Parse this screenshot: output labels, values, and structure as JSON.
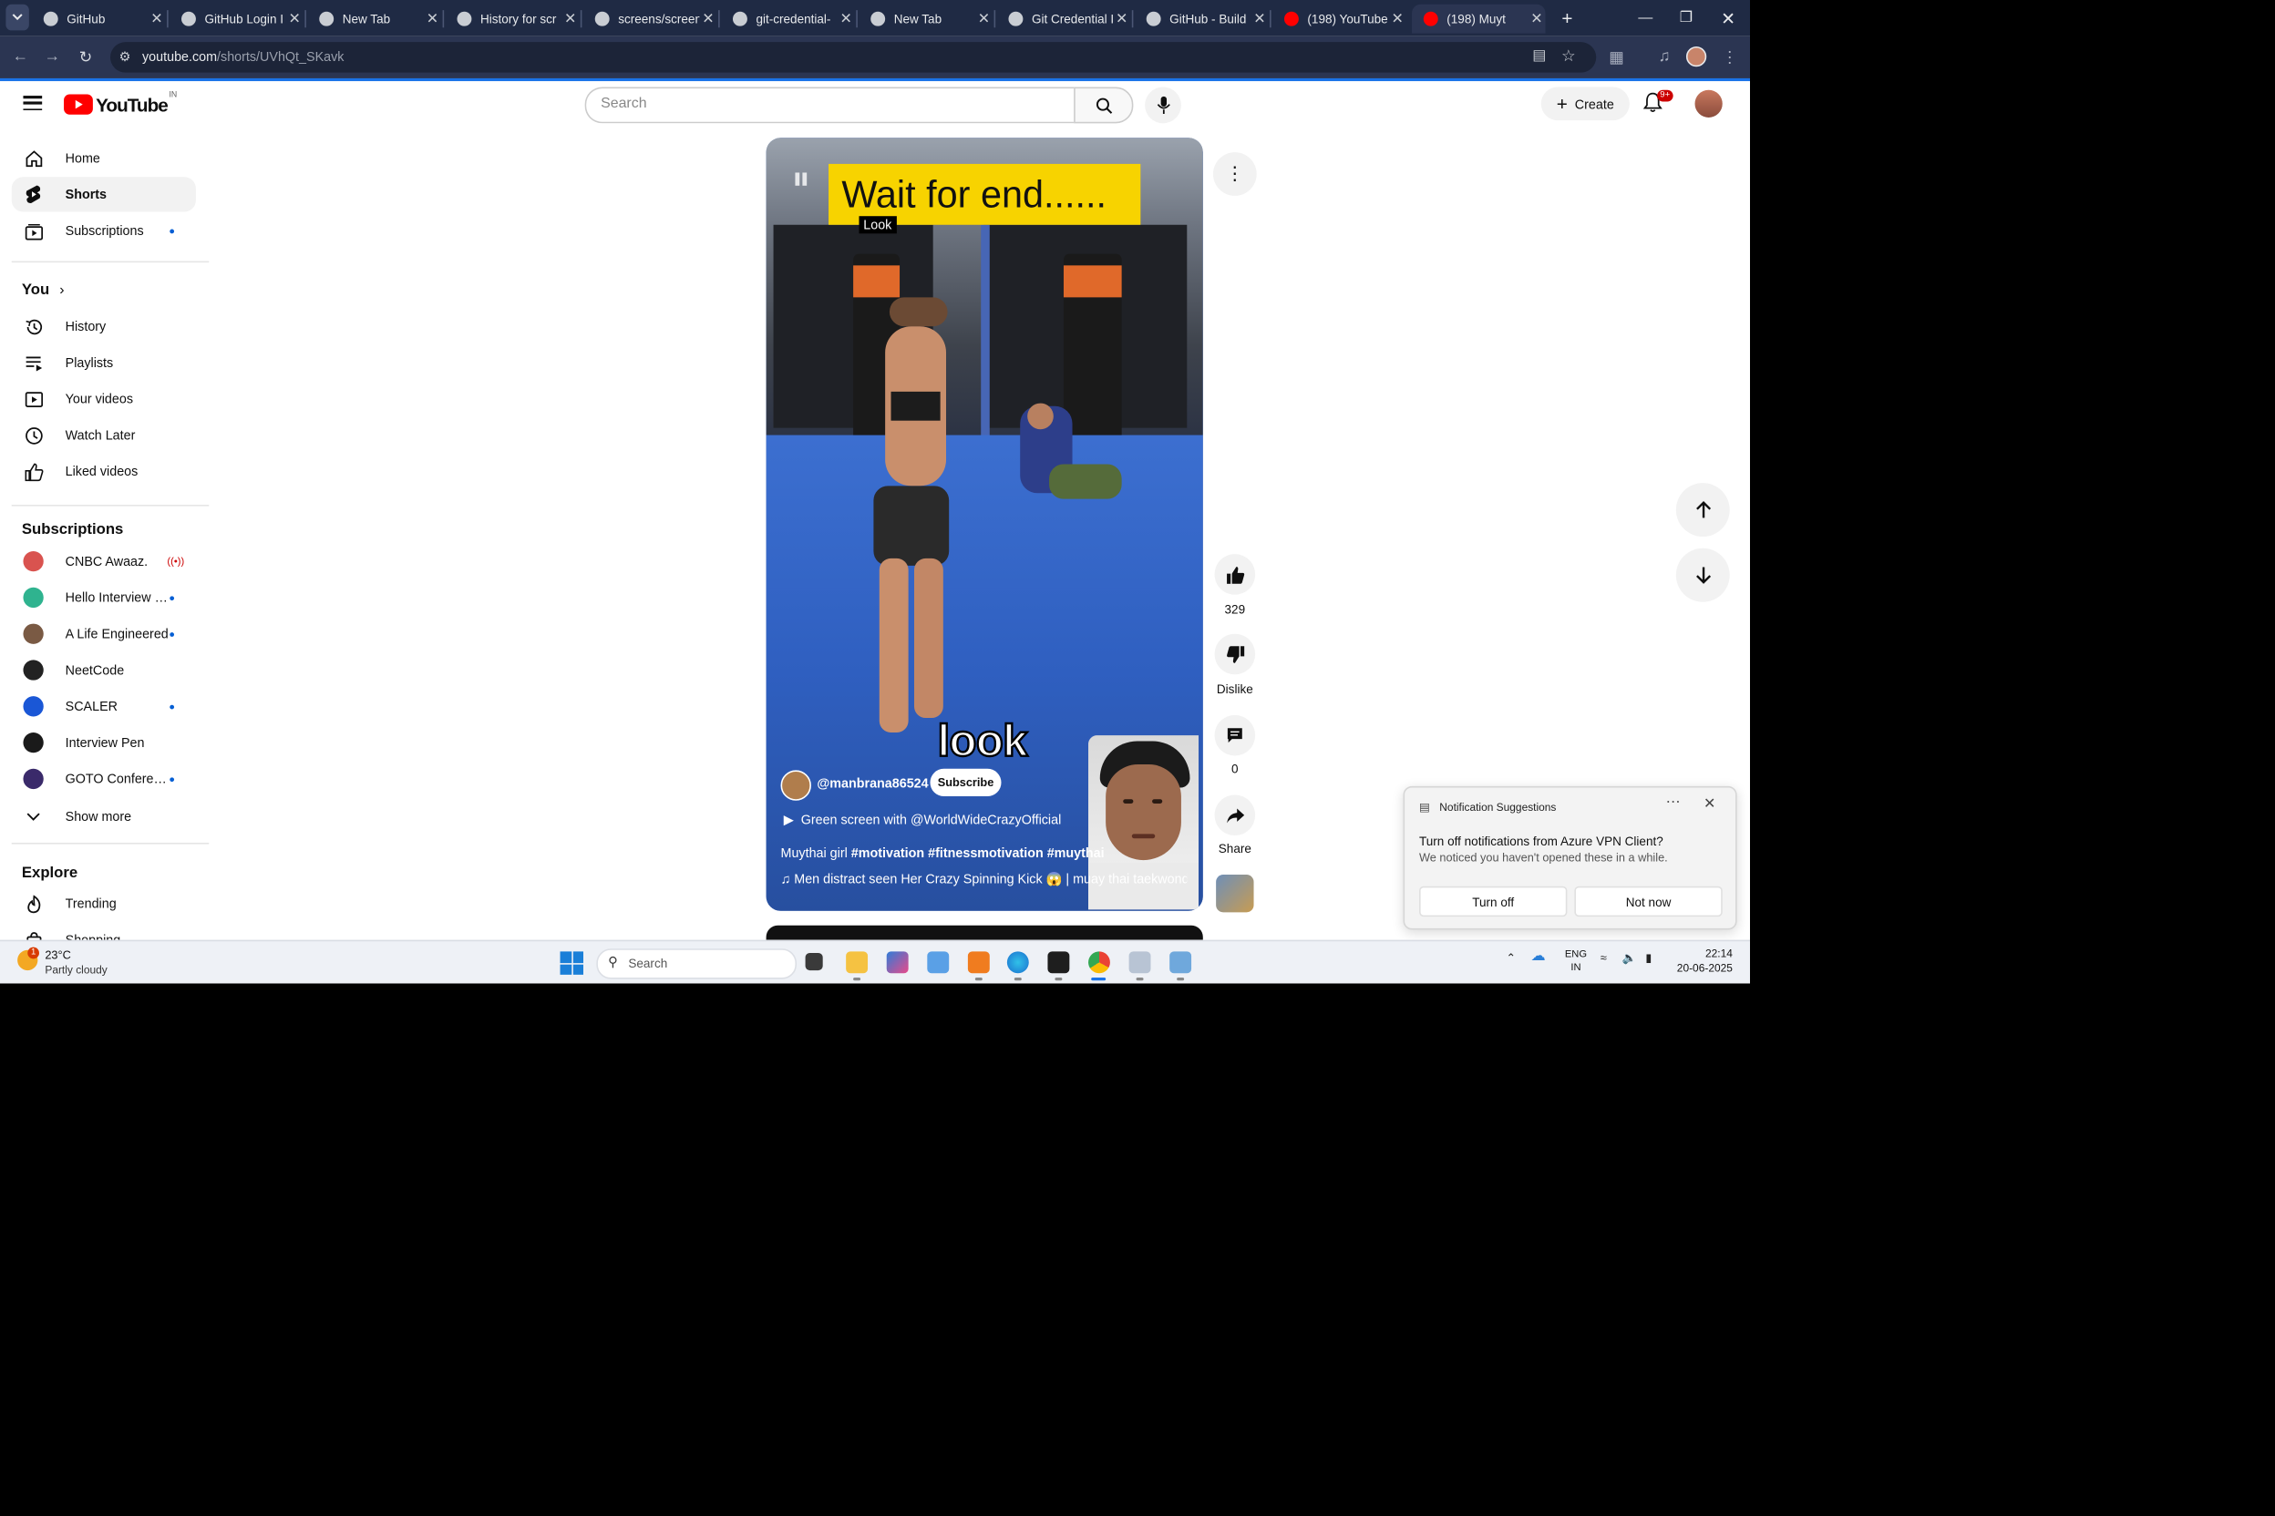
{
  "browser": {
    "tabs": [
      {
        "title": "GitHub",
        "favicon_color": "#c9cdd3"
      },
      {
        "title": "GitHub Login I",
        "favicon_color": "#c9cdd3"
      },
      {
        "title": "New Tab",
        "favicon_color": "#c9cdd3"
      },
      {
        "title": "History for scr",
        "favicon_color": "#c9cdd3"
      },
      {
        "title": "screens/screen",
        "favicon_color": "#c9cdd3"
      },
      {
        "title": "git-credential-",
        "favicon_color": "#c9cdd3"
      },
      {
        "title": "New Tab",
        "favicon_color": "#c9cdd3"
      },
      {
        "title": "Git Credential I",
        "favicon_color": "#c9cdd3"
      },
      {
        "title": "GitHub - Build",
        "favicon_color": "#c9cdd3"
      },
      {
        "title": "(198) YouTube",
        "favicon_color": "#ff0000"
      },
      {
        "title": "(198) Muyt",
        "favicon_color": "#ff0000",
        "active": true
      }
    ],
    "new_tab_icon": "+",
    "url_host": "youtube.com",
    "url_path": "/shorts/UVhQt_SKavk"
  },
  "youtube": {
    "logo_text": "YouTube",
    "country_code": "IN",
    "search_placeholder": "Search",
    "create_label": "Create",
    "notification_badge": "9+"
  },
  "sidebar": {
    "main": [
      {
        "label": "Home",
        "icon": "home-icon"
      },
      {
        "label": "Shorts",
        "icon": "shorts-icon",
        "active": true
      },
      {
        "label": "Subscriptions",
        "icon": "subscriptions-icon",
        "dot": true
      }
    ],
    "you_heading": "You",
    "you": [
      {
        "label": "History",
        "icon": "history-icon"
      },
      {
        "label": "Playlists",
        "icon": "playlists-icon"
      },
      {
        "label": "Your videos",
        "icon": "your-videos-icon"
      },
      {
        "label": "Watch Later",
        "icon": "watch-later-icon"
      },
      {
        "label": "Liked videos",
        "icon": "liked-videos-icon"
      }
    ],
    "subscriptions_heading": "Subscriptions",
    "subscriptions": [
      {
        "label": "CNBC Awaaz.",
        "live": true,
        "avatar_color": "#d9534f"
      },
      {
        "label": "Hello Interview - ...",
        "dot": true,
        "avatar_color": "#2fb38f"
      },
      {
        "label": "A Life Engineered",
        "dot": true,
        "avatar_color": "#7a5a44"
      },
      {
        "label": "NeetCode",
        "avatar_color": "#222222"
      },
      {
        "label": "SCALER",
        "dot": true,
        "avatar_color": "#1a57d6"
      },
      {
        "label": "Interview Pen",
        "avatar_color": "#1a1a1a"
      },
      {
        "label": "GOTO Conferenc...",
        "dot": true,
        "avatar_color": "#3a2a6a"
      }
    ],
    "show_more": "Show more",
    "explore_heading": "Explore",
    "explore": [
      {
        "label": "Trending",
        "icon": "trending-icon"
      },
      {
        "label": "Shopping",
        "icon": "shopping-icon"
      }
    ]
  },
  "short": {
    "banner_text": "Wait for end......",
    "caption_small": "Look",
    "caption_big": "look",
    "channel": "@manbrana86524",
    "subscribe_label": "Subscribe",
    "green_screen": "Green screen with @WorldWideCrazyOfficial",
    "desc_plain": "Muythai girl ",
    "desc_tags": "#motivation #fitnessmotivation #muythai",
    "music": "Men distract seen Her Crazy Spinning Kick 😱 | muay thai taekwondo"
  },
  "actions": {
    "like_count": "329",
    "dislike_label": "Dislike",
    "comment_count": "0",
    "share_label": "Share"
  },
  "notification": {
    "header": "Notification Suggestions",
    "title": "Turn off notifications from Azure VPN Client?",
    "subtitle": "We noticed you haven't opened these in a while.",
    "turn_off_label": "Turn off",
    "not_now_label": "Not now"
  },
  "taskbar": {
    "temperature": "23°C",
    "weather_desc": "Partly cloudy",
    "weather_badge": "1",
    "search_placeholder": "Search",
    "lang_line1": "ENG",
    "lang_line2": "IN",
    "time": "22:14",
    "date": "20-06-2025"
  }
}
